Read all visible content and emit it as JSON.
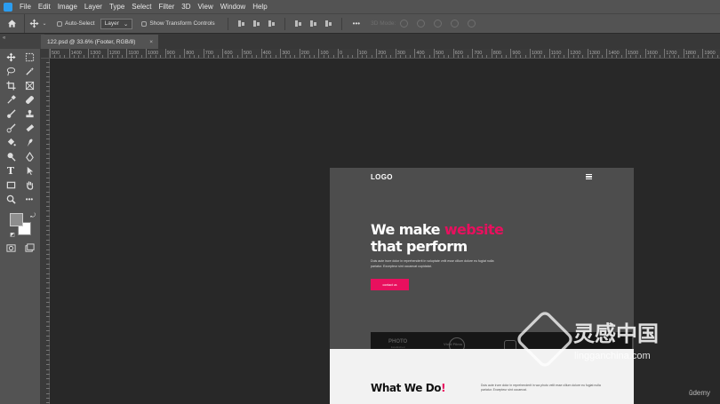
{
  "menu": [
    "File",
    "Edit",
    "Image",
    "Layer",
    "Type",
    "Select",
    "Filter",
    "3D",
    "View",
    "Window",
    "Help"
  ],
  "options": {
    "auto_select": "Auto-Select",
    "target": "Layer",
    "show_transform": "Show Transform Controls",
    "mode_3d": "3D Mode:",
    "more": "•••"
  },
  "tab": {
    "title": "122.psd @ 33.6% (Footer, RGB/8)",
    "close": "×"
  },
  "toolbar_collapse": "«",
  "ruler_labels": [
    "500",
    "1400",
    "1300",
    "1200",
    "1100",
    "1000",
    "900",
    "800",
    "700",
    "600",
    "500",
    "400",
    "300",
    "200",
    "100",
    "0",
    "100",
    "200",
    "300",
    "400",
    "500",
    "600",
    "700",
    "800",
    "900",
    "1000",
    "1100",
    "1200",
    "1300",
    "1400",
    "1500",
    "1600",
    "1700",
    "1800",
    "1900"
  ],
  "doc": {
    "logo": "LOGO",
    "hero_line1_white": "We make ",
    "hero_line1_pink": "website",
    "hero_line2": "that perform",
    "hero_paragraph": "Duis aute irure dolor in reprehenderit in voluptate velit esse cillum dolore eu fugiat nulla pariatur. Excepteur sint occaecat cupidatat.",
    "cta": "contact us",
    "brands": [
      {
        "name": "PHOTO",
        "sub": "Established"
      },
      {
        "name": "Vivid Films",
        "sub": ""
      }
    ],
    "what_we_do": "What We Do",
    "what_we_do_mark": "!",
    "what_we_do_paragraph": "Duis aute irure dolor in reprehenderit in wa photo velit esse cillum dolore eu fugiat nulla pariatur. Excepteur sint occaecat."
  },
  "watermark": {
    "text": "灵感中国",
    "url": "lingganchina.com"
  },
  "udemy": "ûdemy",
  "colors": {
    "accent": "#e8105e",
    "ps_blue": "#2b9df0",
    "panel": "#535353",
    "canvas": "#282828"
  }
}
